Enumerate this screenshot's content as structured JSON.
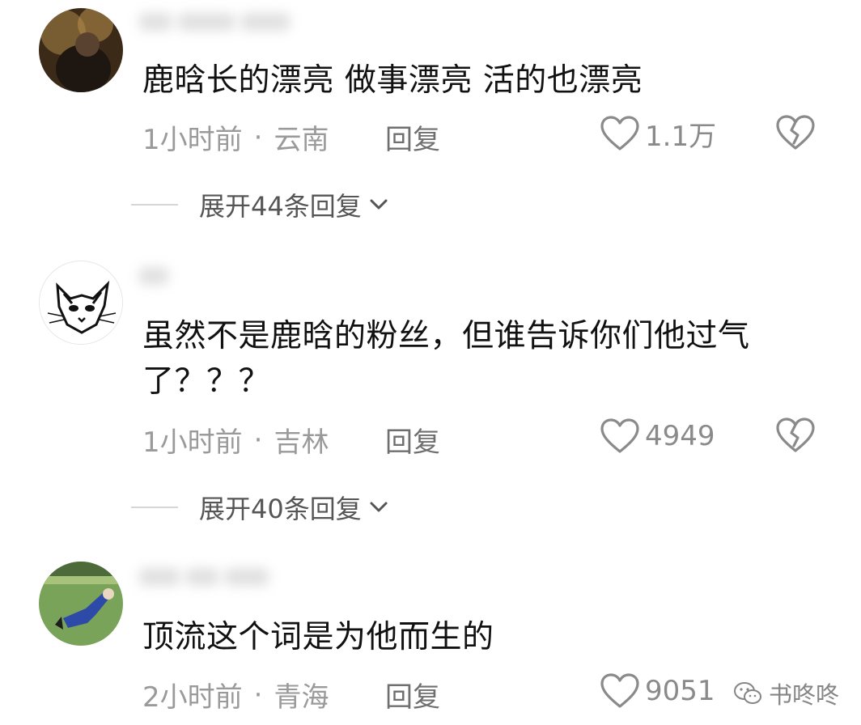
{
  "comments": [
    {
      "text": "鹿晗长的漂亮 做事漂亮  活的也漂亮",
      "time": "1小时前",
      "separator": "·",
      "location": "云南",
      "reply_label": "回复",
      "likes": "1.1万",
      "expand_label": "展开44条回复"
    },
    {
      "text": "虽然不是鹿晗的粉丝，但谁告诉你们他过气了？？？",
      "time": "1小时前",
      "separator": "·",
      "location": "吉林",
      "reply_label": "回复",
      "likes": "4949",
      "expand_label": "展开40条回复"
    },
    {
      "text": "顶流这个词是为他而生的",
      "time": "2小时前",
      "separator": "·",
      "location": "青海",
      "reply_label": "回复",
      "likes": "9051"
    }
  ],
  "watermark": {
    "text": "书咚咚",
    "icon": "wechat-icon"
  },
  "icons": {
    "like": "heart-outline-icon",
    "dislike": "broken-heart-icon",
    "expand": "chevron-down-icon"
  }
}
